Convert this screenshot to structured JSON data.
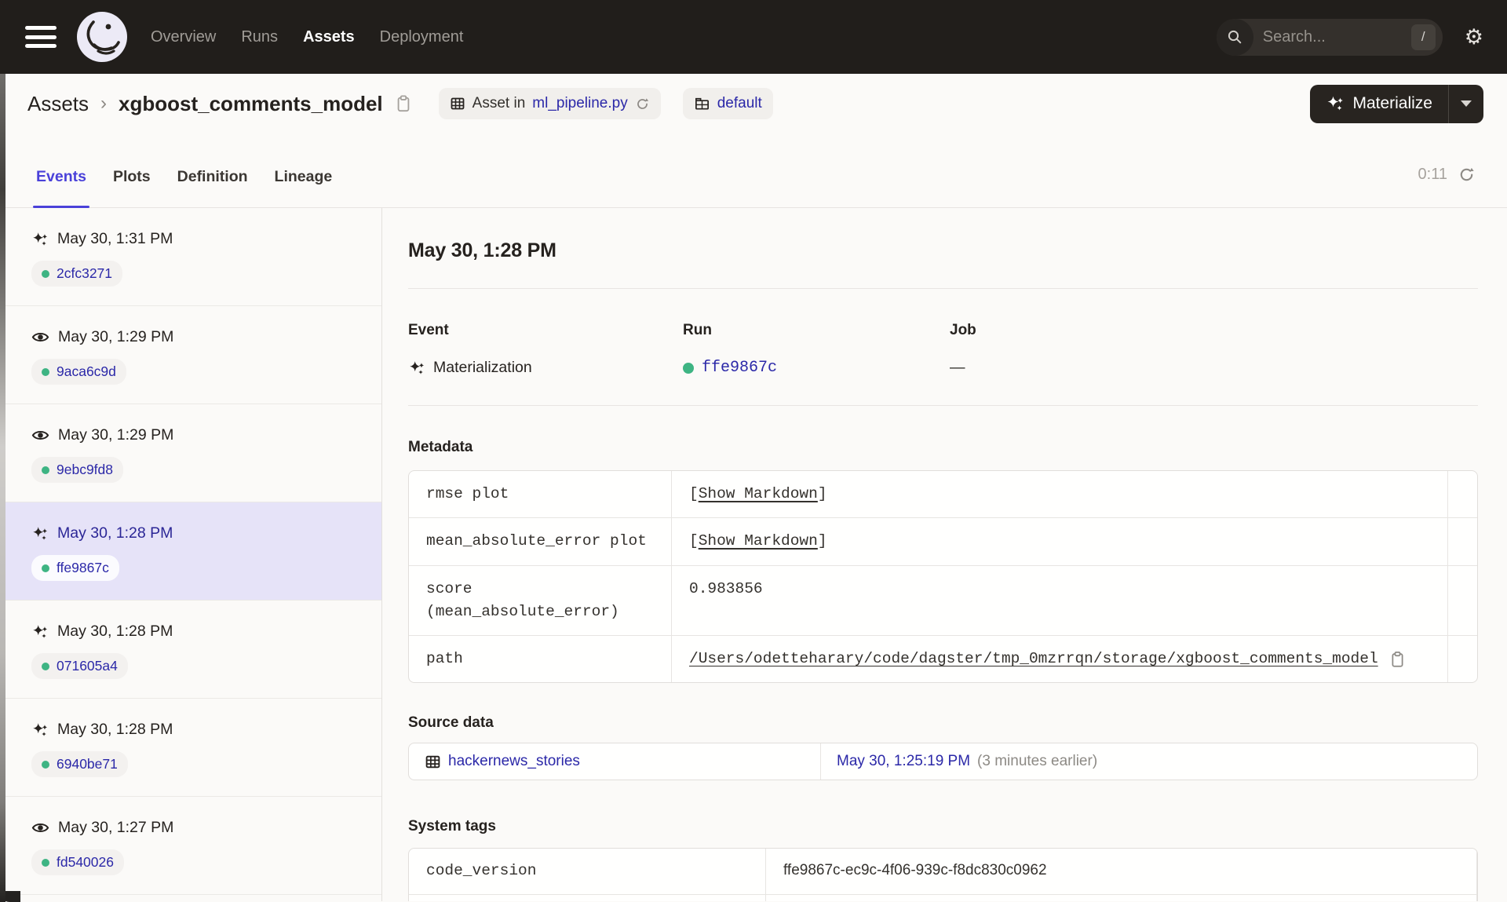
{
  "colors": {
    "header_bg": "#211e1b",
    "accent": "#4a41d9",
    "link": "#2b28a8",
    "green_dot": "#3eb483",
    "selected_bg": "#e6e3f8"
  },
  "header": {
    "nav_items": [
      {
        "label": "Overview",
        "active": false
      },
      {
        "label": "Runs",
        "active": false
      },
      {
        "label": "Assets",
        "active": true
      },
      {
        "label": "Deployment",
        "active": false
      }
    ],
    "search_placeholder": "Search...",
    "search_shortcut": "/"
  },
  "breadcrumb": {
    "root": "Assets",
    "separator": "›",
    "asset_name": "xgboost_comments_model"
  },
  "context_badges": {
    "asset_in_label": "Asset in",
    "asset_in_file": "ml_pipeline.py",
    "group_label": "default"
  },
  "materialize_button": {
    "label": "Materialize"
  },
  "tabs": [
    {
      "label": "Events",
      "active": true
    },
    {
      "label": "Plots",
      "active": false
    },
    {
      "label": "Definition",
      "active": false
    },
    {
      "label": "Lineage",
      "active": false
    }
  ],
  "auto_refresh": {
    "countdown": "0:11"
  },
  "event_list": [
    {
      "type": "materialization",
      "time": "May 30, 1:31 PM",
      "run_id": "2cfc3271",
      "selected": false
    },
    {
      "type": "observation",
      "time": "May 30, 1:29 PM",
      "run_id": "9aca6c9d",
      "selected": false
    },
    {
      "type": "observation",
      "time": "May 30, 1:29 PM",
      "run_id": "9ebc9fd8",
      "selected": false
    },
    {
      "type": "materialization",
      "time": "May 30, 1:28 PM",
      "run_id": "ffe9867c",
      "selected": true
    },
    {
      "type": "materialization",
      "time": "May 30, 1:28 PM",
      "run_id": "071605a4",
      "selected": false
    },
    {
      "type": "materialization",
      "time": "May 30, 1:28 PM",
      "run_id": "6940be71",
      "selected": false
    },
    {
      "type": "observation",
      "time": "May 30, 1:27 PM",
      "run_id": "fd540026",
      "selected": false
    }
  ],
  "detail": {
    "title": "May 30, 1:28 PM",
    "event": {
      "label": "Event",
      "value": "Materialization"
    },
    "run": {
      "label": "Run",
      "value": "ffe9867c"
    },
    "job": {
      "label": "Job",
      "value": "—"
    },
    "metadata": {
      "heading": "Metadata",
      "bracket_open": "[",
      "bracket_close": "]",
      "show_markdown_label": "Show Markdown",
      "rows": [
        {
          "key": "rmse plot"
        },
        {
          "key": "mean_absolute_error plot"
        },
        {
          "key": "score\n(mean_absolute_error)",
          "value": "0.983856"
        },
        {
          "key": "path",
          "value": "/Users/odetteharary/code/dagster/tmp_0mzrrqn/storage/xgboost_comments_model"
        }
      ]
    },
    "source_data": {
      "heading": "Source data",
      "asset_link": "hackernews_stories",
      "timestamp_link": "May 30, 1:25:19 PM",
      "note": "(3 minutes earlier)"
    },
    "system_tags": {
      "heading": "System tags",
      "rows": [
        {
          "key": "code_version",
          "value": "ffe9867c-ec9c-4f06-939c-f8dc830c0962"
        }
      ]
    }
  }
}
